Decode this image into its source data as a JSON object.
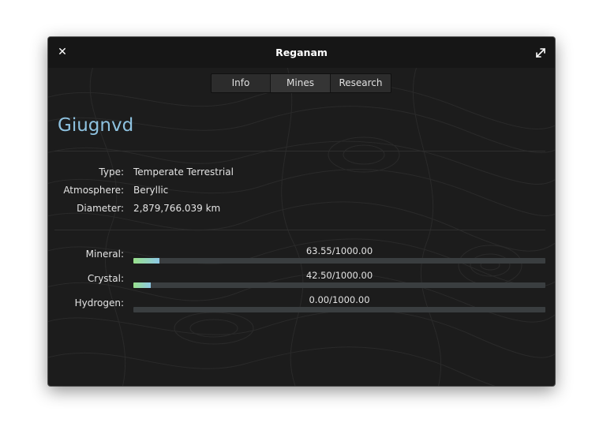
{
  "window": {
    "title": "Reganam",
    "close_icon": "close-icon",
    "maximize_icon": "maximize-icon"
  },
  "tabs": [
    {
      "label": "Info",
      "active": false
    },
    {
      "label": "Mines",
      "active": true
    },
    {
      "label": "Research",
      "active": false
    }
  ],
  "planet": {
    "name": "Giugnvd",
    "info": [
      {
        "label": "Type:",
        "value": "Temperate Terrestrial"
      },
      {
        "label": "Atmosphere:",
        "value": "Beryllic"
      },
      {
        "label": "Diameter:",
        "value": "2,879,766.039 km"
      }
    ]
  },
  "resources": [
    {
      "label": "Mineral:",
      "value_text": "63.55/1000.00",
      "fraction": 0.06355
    },
    {
      "label": "Crystal:",
      "value_text": "42.50/1000.00",
      "fraction": 0.0425
    },
    {
      "label": "Hydrogen:",
      "value_text": "0.00/1000.00",
      "fraction": 0.0
    }
  ],
  "colors": {
    "accent": "#8ec2e0",
    "bar_fill_start": "#98e08a",
    "bar_fill_end": "#8ec8e6",
    "bar_track": "#3a3e40",
    "window_bg": "#1c1c1c"
  }
}
